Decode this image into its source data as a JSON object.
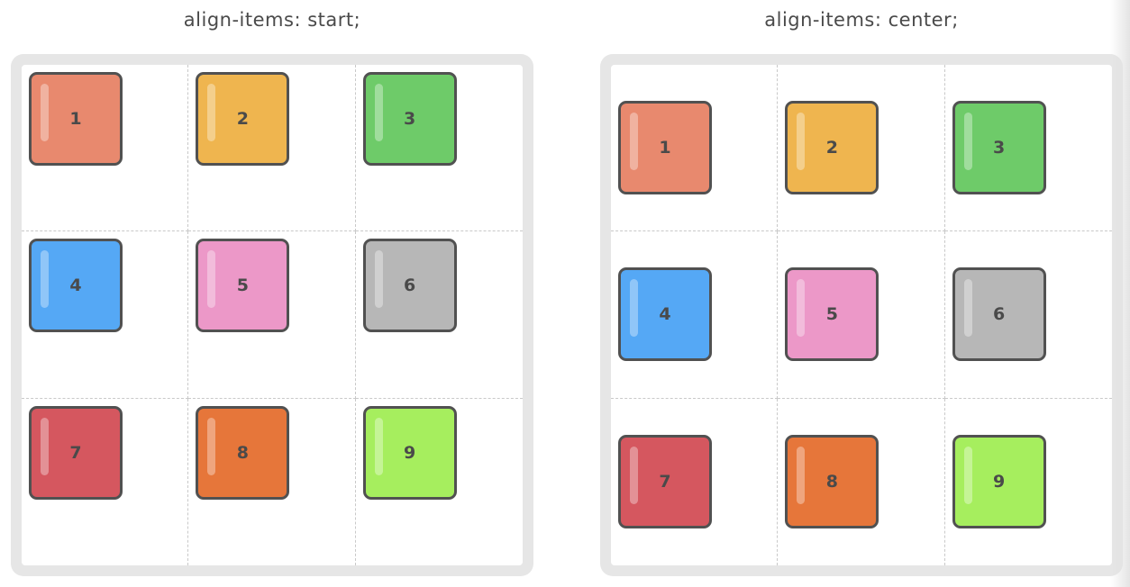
{
  "panels": [
    {
      "title": "align-items: start;",
      "mode": "start",
      "items": [
        {
          "label": "1",
          "color": "#E8896E"
        },
        {
          "label": "2",
          "color": "#EFB54F"
        },
        {
          "label": "3",
          "color": "#6ECB69"
        },
        {
          "label": "4",
          "color": "#55A8F5"
        },
        {
          "label": "5",
          "color": "#EC98C8"
        },
        {
          "label": "6",
          "color": "#B7B7B7"
        },
        {
          "label": "7",
          "color": "#D5575F"
        },
        {
          "label": "8",
          "color": "#E6763A"
        },
        {
          "label": "9",
          "color": "#A6EE5E"
        }
      ]
    },
    {
      "title": "align-items: center;",
      "mode": "center",
      "items": [
        {
          "label": "1",
          "color": "#E8896E"
        },
        {
          "label": "2",
          "color": "#EFB54F"
        },
        {
          "label": "3",
          "color": "#6ECB69"
        },
        {
          "label": "4",
          "color": "#55A8F5"
        },
        {
          "label": "5",
          "color": "#EC98C8"
        },
        {
          "label": "6",
          "color": "#B7B7B7"
        },
        {
          "label": "7",
          "color": "#D5575F"
        },
        {
          "label": "8",
          "color": "#E6763A"
        },
        {
          "label": "9",
          "color": "#A6EE5E"
        }
      ]
    }
  ]
}
